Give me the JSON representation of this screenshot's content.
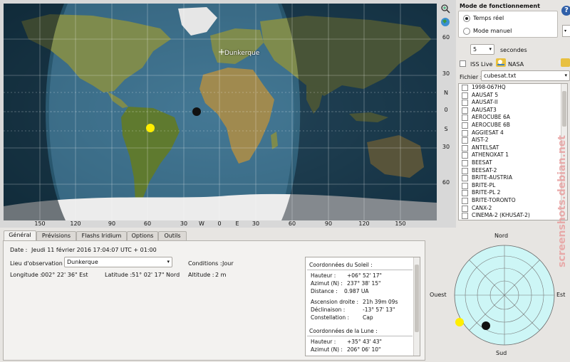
{
  "map": {
    "city_label": "Dunkerque",
    "lat_labels": [
      "60",
      "30",
      "N",
      "0",
      "S",
      "30",
      "60"
    ],
    "lon_labels": [
      "150",
      "120",
      "90",
      "60",
      "30",
      "W",
      "0",
      "E",
      "30",
      "60",
      "90",
      "120",
      "150"
    ],
    "colors": {
      "ocean": "#2a5770",
      "land": "#7b8a4a",
      "night": "#0e2334",
      "ice": "#ececec"
    }
  },
  "toolbar": {
    "zoom_icon": "zoom-in-icon",
    "globe_icon": "globe-icon"
  },
  "mode": {
    "title": "Mode de fonctionnement",
    "realtime_label": "Temps réel",
    "manual_label": "Mode manuel",
    "interval_value": "5",
    "interval_unit": "secondes",
    "iss_live_label": "ISS Live",
    "nasa_label": "NASA",
    "file_label": "Fichier :",
    "file_value": "cubesat.txt"
  },
  "satellites": [
    "1998-067HQ",
    "AAUSAT 5",
    "AAUSAT-II",
    "AAUSAT3",
    "AEROCUBE 6A",
    "AEROCUBE 6B",
    "AGGIESAT 4",
    "AIST-2",
    "ANTELSAT",
    "ATHENOXAT 1",
    "BEESAT",
    "BEESAT-2",
    "BRITE-AUSTRIA",
    "BRITE-PL",
    "BRITE-PL 2",
    "BRITE-TORONTO",
    "CANX-2",
    "CINEMA-2 (KHUSAT-2)"
  ],
  "tabs": [
    "Général",
    "Prévisions",
    "Flashs Iridium",
    "Options",
    "Outils"
  ],
  "general": {
    "date_label": "Date :",
    "date_value": "Jeudi 11 février 2016 17:04:07  UTC + 01:00",
    "location_label": "Lieu d'observation :",
    "location_value": "Dunkerque",
    "conditions_label": "Conditions :",
    "conditions_value": "Jour",
    "longitude_label": "Longitude :",
    "longitude_value": "002° 22' 36\" Est",
    "latitude_label": "Latitude :",
    "latitude_value": "51° 02' 17\" Nord",
    "altitude_label": "Altitude :",
    "altitude_value": "2 m"
  },
  "sun": {
    "title": "Coordonnées du Soleil :",
    "rows": [
      {
        "label": "Hauteur :",
        "value": "+06° 52' 17\""
      },
      {
        "label": "Azimut (N) :",
        "value": "237° 38' 15\""
      },
      {
        "label": "Distance :",
        "value": "0.987 UA"
      },
      {
        "label": "Ascension droite :",
        "value": "21h 39m 09s"
      },
      {
        "label": "Déclinaison :",
        "value": "-13° 57' 13\""
      },
      {
        "label": "Constellation :",
        "value": "Cap"
      }
    ]
  },
  "moon": {
    "title": "Coordonnées de la Lune :",
    "rows": [
      {
        "label": "Hauteur :",
        "value": "+35° 43' 43\""
      },
      {
        "label": "Azimut (N) :",
        "value": "206° 06' 10\""
      }
    ]
  },
  "sky": {
    "north": "Nord",
    "south": "Sud",
    "east": "Est",
    "west": "Ouest"
  },
  "watermark": "screenshots.debian.net"
}
